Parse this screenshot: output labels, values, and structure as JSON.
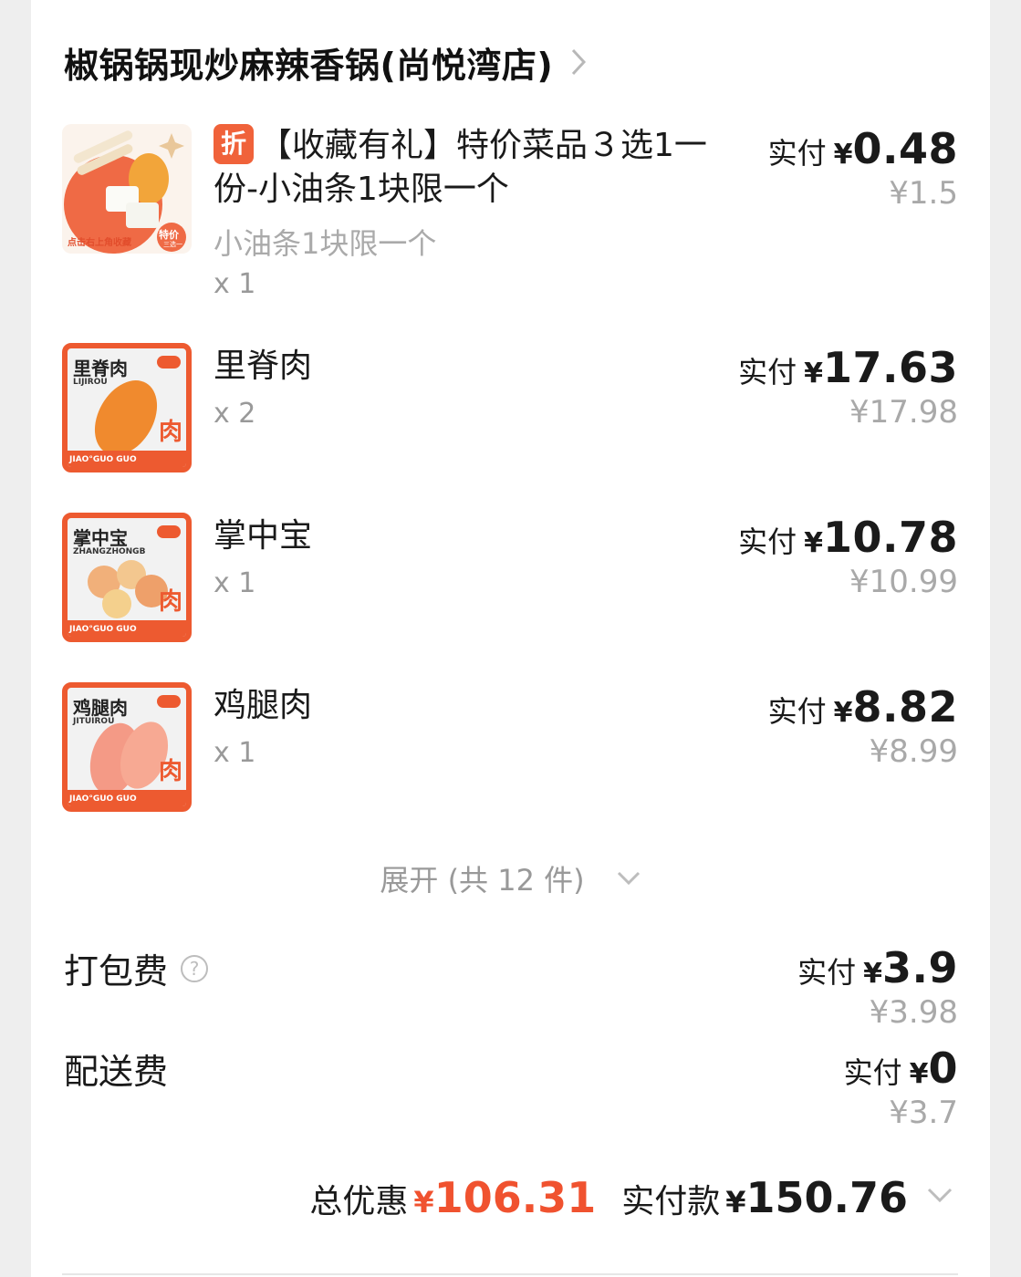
{
  "store": {
    "name": "椒锅锅现炒麻辣香锅(尚悦湾店)"
  },
  "currency": "¥",
  "paid_label": "实付",
  "items": [
    {
      "tag": "折",
      "title_line1": "【收藏有礼】特价菜品３选1一",
      "title_line2": "份-小油条1块限一个",
      "spec": "小油条1块限一个",
      "qty": "x 1",
      "paid": "0.48",
      "original": "¥1.5",
      "thumb_caption": "点击右上角收藏",
      "thumb_badge": "特价",
      "thumb_badge_sub": "三选一"
    },
    {
      "title": "里脊肉",
      "qty": "x 2",
      "paid": "17.63",
      "original": "¥17.98",
      "thumb_title": "里脊肉",
      "thumb_pinyin": "LIJIROU"
    },
    {
      "title": "掌中宝",
      "qty": "x 1",
      "paid": "10.78",
      "original": "¥10.99",
      "thumb_title": "掌中宝",
      "thumb_pinyin": "ZHANGZHONGB"
    },
    {
      "title": "鸡腿肉",
      "qty": "x 1",
      "paid": "8.82",
      "original": "¥8.99",
      "thumb_title": "鸡腿肉",
      "thumb_pinyin": "JITUIROU"
    }
  ],
  "thumb_brand": "JIAO°GUO GUO",
  "thumb_char": "肉",
  "expand_label": "展开 (共 12 件)",
  "fees": [
    {
      "label": "打包费",
      "paid": "3.9",
      "original": "¥3.98",
      "help": "?"
    },
    {
      "label": "配送费",
      "paid": "0",
      "original": "¥3.7"
    }
  ],
  "totals": {
    "discount_label": "总优惠",
    "discount_value": "106.31",
    "paid_label": "实付款",
    "paid_value": "150.76"
  },
  "colors": {
    "accent": "#f0522f",
    "tag": "#f0623a",
    "muted": "#a9a9a9"
  }
}
